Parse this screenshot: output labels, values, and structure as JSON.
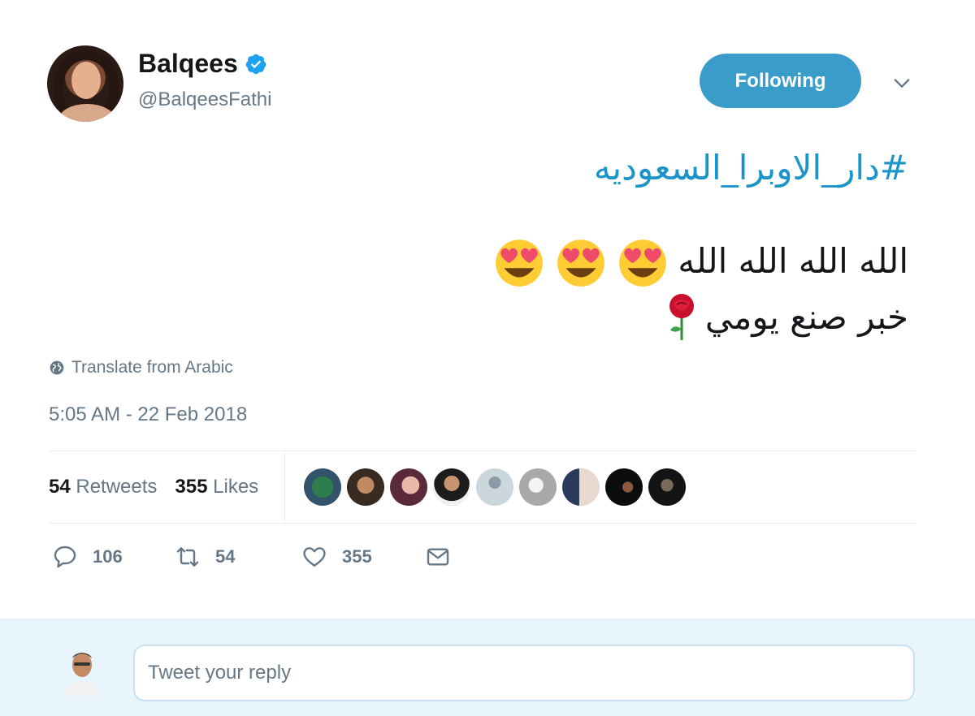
{
  "user": {
    "name": "Balqees",
    "handle": "@BalqeesFathi",
    "verified": true
  },
  "follow_button": {
    "label": "Following"
  },
  "tweet": {
    "hashtag": "#دار_الاوبرا_السعوديه",
    "line1_text": "الله الله الله الله",
    "line1_emojis": [
      "smiling-face-with-heart-eyes",
      "smiling-face-with-heart-eyes",
      "smiling-face-with-heart-eyes"
    ],
    "line2_text": "خبر صنع يومي",
    "line2_emoji": "rose"
  },
  "translate": {
    "label": "Translate from Arabic",
    "icon": "globe-icon"
  },
  "timestamp": "5:05 AM - 22 Feb 2018",
  "stats": {
    "retweets_count": "54",
    "retweets_label": "Retweets",
    "likes_count": "355",
    "likes_label": "Likes"
  },
  "actions": {
    "reply_count": "106",
    "retweet_count": "54",
    "like_count": "355"
  },
  "reply": {
    "placeholder": "Tweet your reply"
  },
  "colors": {
    "accent": "#1b95c9",
    "button": "#3a9cc9",
    "muted": "#657786",
    "reply_bg": "#e8f5fd"
  }
}
